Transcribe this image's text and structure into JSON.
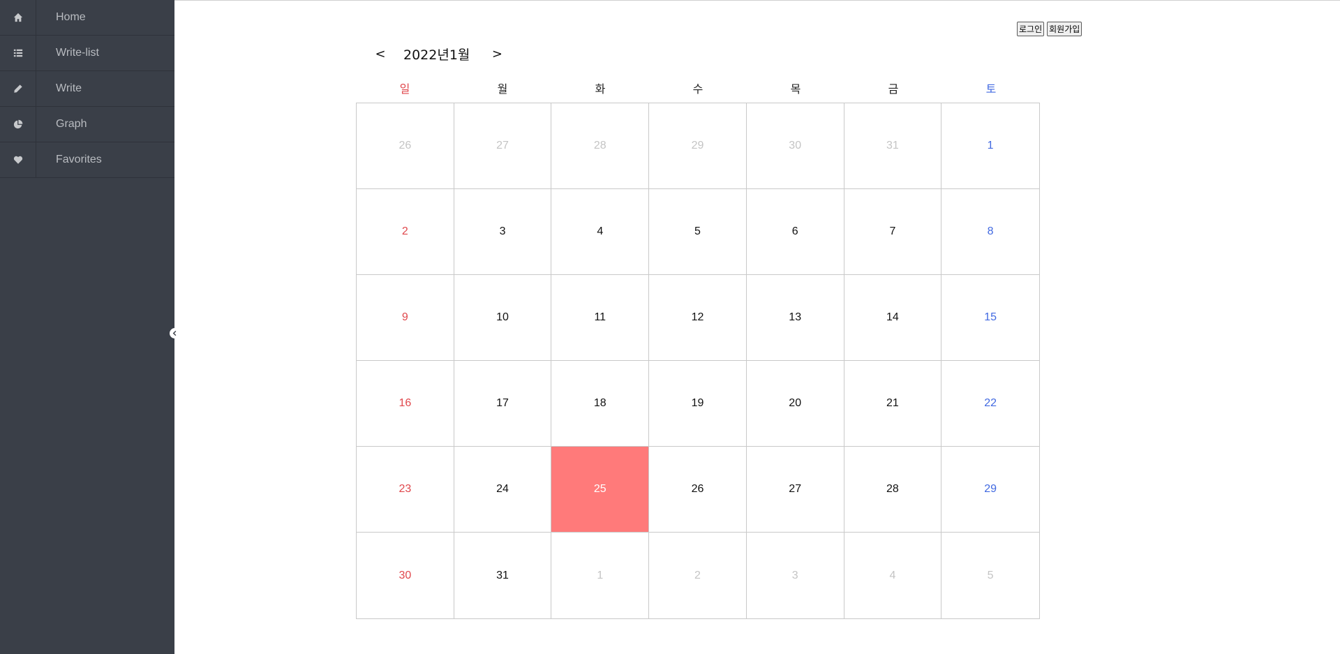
{
  "sidebar": {
    "items": [
      {
        "label": "Home",
        "icon": "home-icon"
      },
      {
        "label": "Write-list",
        "icon": "list-icon"
      },
      {
        "label": "Write",
        "icon": "pencil-icon"
      },
      {
        "label": "Graph",
        "icon": "pie-chart-icon"
      },
      {
        "label": "Favorites",
        "icon": "heart-icon"
      }
    ],
    "toggle_icon": "chevron-left-icon"
  },
  "auth": {
    "login_label": "로그인",
    "signup_label": "회원가입"
  },
  "calendar": {
    "prev_label": "<",
    "next_label": ">",
    "title": "2022년1월",
    "weekdays": [
      "일",
      "월",
      "화",
      "수",
      "목",
      "금",
      "토"
    ],
    "days": [
      {
        "d": "26",
        "muted": true
      },
      {
        "d": "27",
        "muted": true
      },
      {
        "d": "28",
        "muted": true
      },
      {
        "d": "29",
        "muted": true
      },
      {
        "d": "30",
        "muted": true
      },
      {
        "d": "31",
        "muted": true
      },
      {
        "d": "1"
      },
      {
        "d": "2"
      },
      {
        "d": "3"
      },
      {
        "d": "4"
      },
      {
        "d": "5"
      },
      {
        "d": "6"
      },
      {
        "d": "7"
      },
      {
        "d": "8"
      },
      {
        "d": "9"
      },
      {
        "d": "10"
      },
      {
        "d": "11"
      },
      {
        "d": "12"
      },
      {
        "d": "13"
      },
      {
        "d": "14"
      },
      {
        "d": "15"
      },
      {
        "d": "16"
      },
      {
        "d": "17"
      },
      {
        "d": "18"
      },
      {
        "d": "19"
      },
      {
        "d": "20"
      },
      {
        "d": "21"
      },
      {
        "d": "22"
      },
      {
        "d": "23"
      },
      {
        "d": "24"
      },
      {
        "d": "25",
        "today": true
      },
      {
        "d": "26"
      },
      {
        "d": "27"
      },
      {
        "d": "28"
      },
      {
        "d": "29"
      },
      {
        "d": "30"
      },
      {
        "d": "31"
      },
      {
        "d": "1",
        "muted": true
      },
      {
        "d": "2",
        "muted": true
      },
      {
        "d": "3",
        "muted": true
      },
      {
        "d": "4",
        "muted": true
      },
      {
        "d": "5",
        "muted": true
      }
    ]
  },
  "colors": {
    "sidebar_bg": "#3a3f48",
    "sunday": "#e0474c",
    "saturday": "#4169e1",
    "today_bg": "#ff7a7a",
    "muted": "#c4c4c4"
  }
}
